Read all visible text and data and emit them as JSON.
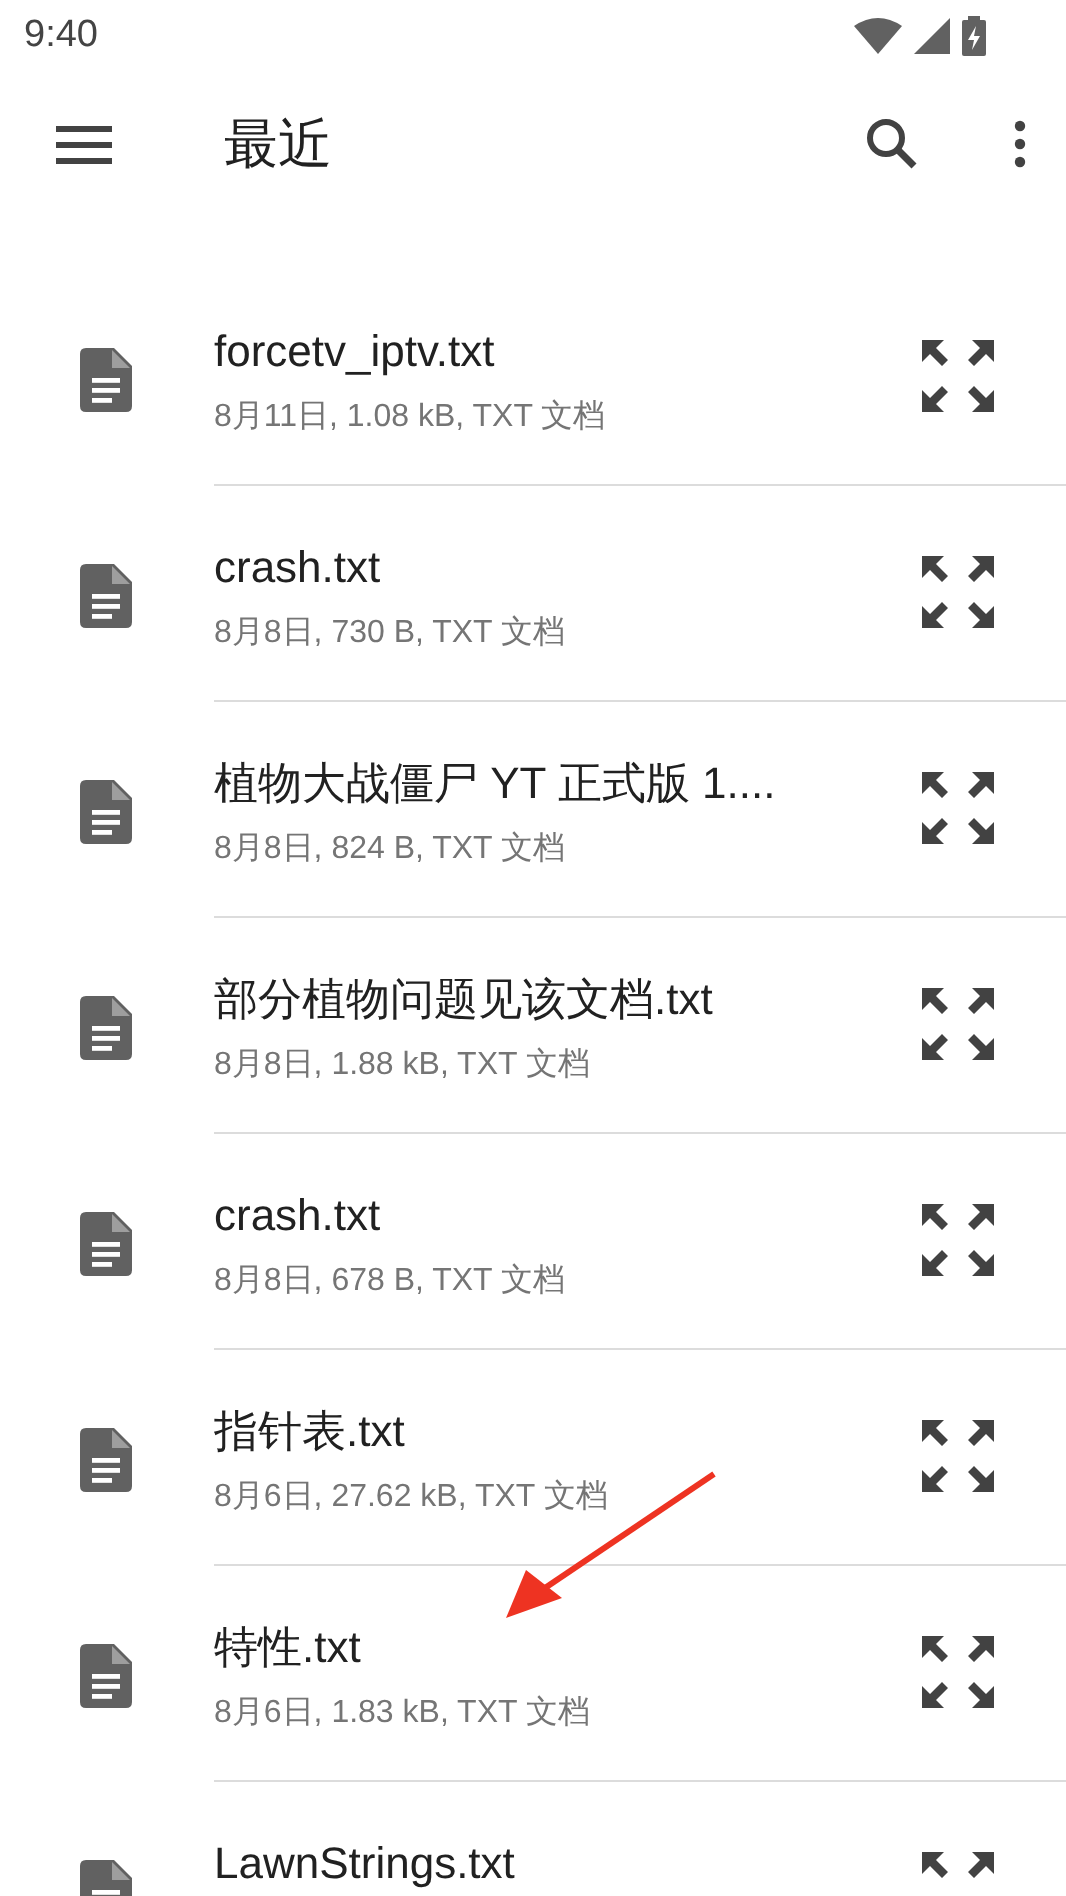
{
  "status_bar": {
    "time": "9:40"
  },
  "app_bar": {
    "title": "最近"
  },
  "files": [
    {
      "name": "forcetv_iptv.txt",
      "details": "8月11日, 1.08 kB, TXT 文档"
    },
    {
      "name": "crash.txt",
      "details": "8月8日, 730 B, TXT 文档"
    },
    {
      "name": "植物大战僵尸 YT 正式版 1....",
      "details": "8月8日, 824 B, TXT 文档"
    },
    {
      "name": "部分植物问题见该文档.txt",
      "details": "8月8日, 1.88 kB, TXT 文档"
    },
    {
      "name": "crash.txt",
      "details": "8月8日, 678 B, TXT 文档"
    },
    {
      "name": "指针表.txt",
      "details": "8月6日, 27.62 kB, TXT 文档"
    },
    {
      "name": "特性.txt",
      "details": "8月6日, 1.83 kB, TXT 文档"
    },
    {
      "name": "LawnStrings.txt"
    }
  ]
}
